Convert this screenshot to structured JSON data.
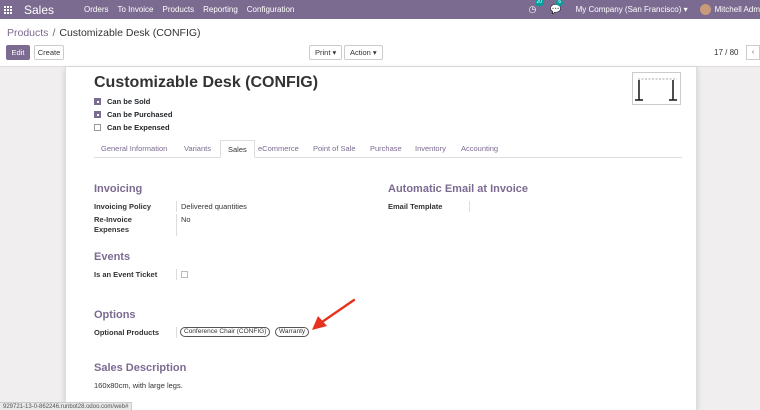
{
  "nav": {
    "app_name": "Sales",
    "menu": [
      "Orders",
      "To Invoice",
      "Products",
      "Reporting",
      "Configuration"
    ],
    "activity_count": "20",
    "message_count": "6",
    "company": "My Company (San Francisco)",
    "company_caret": "▾",
    "user": "Mitchell Adm"
  },
  "control": {
    "breadcrumb_root": "Products",
    "breadcrumb_separator": "/",
    "breadcrumb_current": "Customizable Desk (CONFIG)",
    "edit_label": "Edit",
    "create_label": "Create",
    "print_label": "Print ▾",
    "action_label": "Action ▾",
    "pager": "17 / 80"
  },
  "form": {
    "title": "Customizable Desk (CONFIG)",
    "checkboxes": [
      {
        "label": "Can be Sold",
        "checked": true
      },
      {
        "label": "Can be Purchased",
        "checked": true
      },
      {
        "label": "Can be Expensed",
        "checked": false
      }
    ],
    "tabs": [
      "General Information",
      "Variants",
      "Sales",
      "eCommerce",
      "Point of Sale",
      "Purchase",
      "Inventory",
      "Accounting"
    ],
    "active_tab": "Sales",
    "invoicing": {
      "title": "Invoicing",
      "policy_label": "Invoicing Policy",
      "policy_value": "Delivered quantities",
      "reinvoice_label": "Re-Invoice Expenses",
      "reinvoice_value": "No"
    },
    "auto_email": {
      "title": "Automatic Email at Invoice",
      "template_label": "Email Template"
    },
    "events": {
      "title": "Events",
      "ticket_label": "Is an Event Ticket"
    },
    "options": {
      "title": "Options",
      "optional_label": "Optional Products",
      "tags": [
        "Conference Chair (CONFIG)",
        "Warranty"
      ]
    },
    "sales_description": {
      "title": "Sales Description",
      "text": "160x80cm, with large legs."
    }
  },
  "status_url": "929721-13-0-862246.runbot28.odoo.com/web#",
  "colors": {
    "brand": "#7c6b91",
    "annotation_arrow": "#e8321e"
  }
}
